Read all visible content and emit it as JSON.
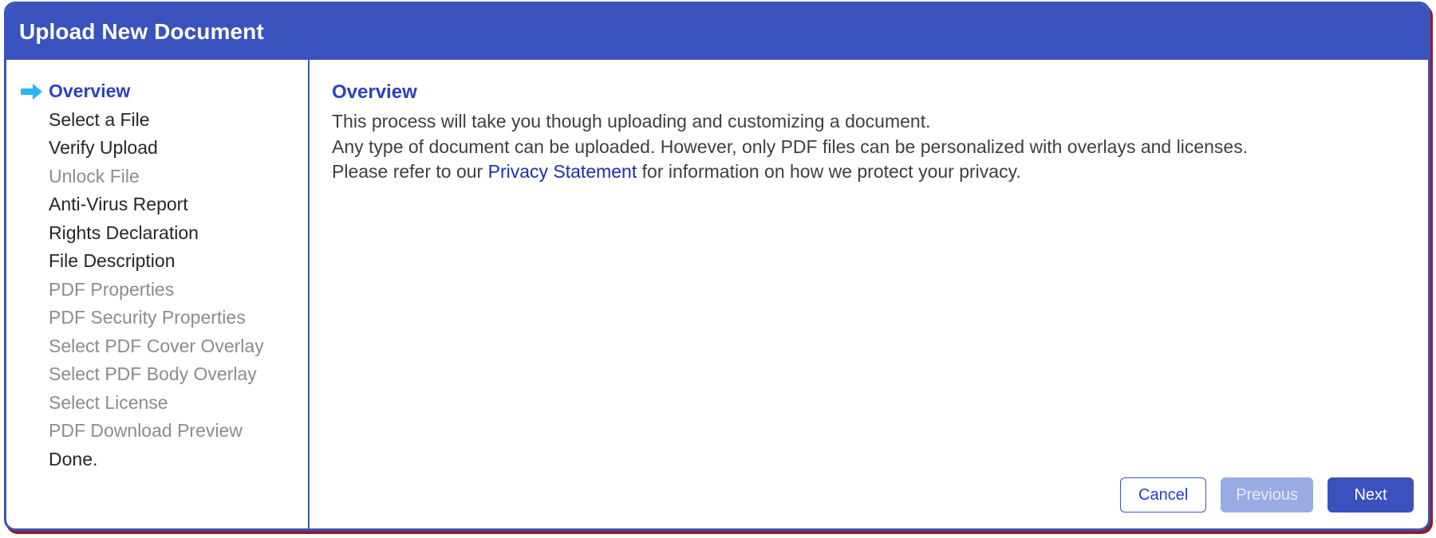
{
  "window": {
    "title": "Upload New Document",
    "accent_color": "#3a52bd",
    "link_color": "#1a2fb5",
    "disabled_text_color": "#8c8c8c",
    "border_color": "#3b53be",
    "shadow_color": "#8f1f25"
  },
  "sidebar": {
    "current_marker_icon": "right-arrow-icon",
    "current_marker_color": "#29b6f6",
    "steps": [
      {
        "label": "Overview",
        "state": "current"
      },
      {
        "label": "Select a File",
        "state": "enabled"
      },
      {
        "label": "Verify Upload",
        "state": "enabled"
      },
      {
        "label": "Unlock File",
        "state": "disabled"
      },
      {
        "label": "Anti-Virus Report",
        "state": "enabled"
      },
      {
        "label": "Rights Declaration",
        "state": "enabled"
      },
      {
        "label": "File Description",
        "state": "enabled"
      },
      {
        "label": "PDF Properties",
        "state": "disabled"
      },
      {
        "label": "PDF Security Properties",
        "state": "disabled"
      },
      {
        "label": "Select PDF Cover Overlay",
        "state": "disabled"
      },
      {
        "label": "Select PDF Body Overlay",
        "state": "disabled"
      },
      {
        "label": "Select License",
        "state": "disabled"
      },
      {
        "label": "PDF Download Preview",
        "state": "disabled"
      },
      {
        "label": "Done.",
        "state": "enabled"
      }
    ]
  },
  "main": {
    "heading": "Overview",
    "paragraph_1": "This process will take you though uploading and customizing a document.",
    "paragraph_2": "Any type of document can be uploaded. However, only PDF files can be personalized with overlays and licenses.",
    "paragraph_3_prefix": "Please refer to our ",
    "privacy_link": "Privacy Statement",
    "paragraph_3_suffix": " for information on how we protect your privacy."
  },
  "footer": {
    "cancel_label": "Cancel",
    "previous_label": "Previous",
    "next_label": "Next"
  }
}
